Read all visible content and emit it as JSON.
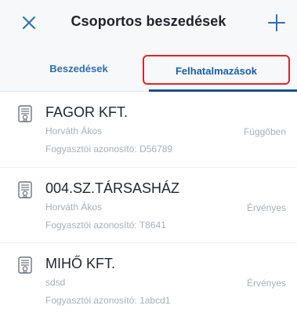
{
  "header": {
    "title": "Csoportos beszedések",
    "close_icon": "close-icon",
    "add_icon": "plus-icon",
    "accent_color": "#2f6fb0"
  },
  "tabs": [
    {
      "label": "Beszedések",
      "selected": false
    },
    {
      "label": "Felhatalmazások",
      "selected": true
    }
  ],
  "items": [
    {
      "name": "FAGOR KFT.",
      "person": "Horváth Ákos",
      "consumer_id": "Fogyasztói azonosító: D56789",
      "status": "Függőben",
      "icon": "certificate-document-icon"
    },
    {
      "name": "004.SZ.TÁRSASHÁZ",
      "person": "Horváth Ákos",
      "consumer_id": "Fogyasztói azonosító: T8641",
      "status": "Érvényes",
      "icon": "certificate-document-icon"
    },
    {
      "name": "MIHŐ KFT.",
      "person": "sdsd",
      "consumer_id": "Fogyasztói azonosító: 1abcd1",
      "status": "Érvényes",
      "icon": "certificate-document-icon"
    }
  ]
}
